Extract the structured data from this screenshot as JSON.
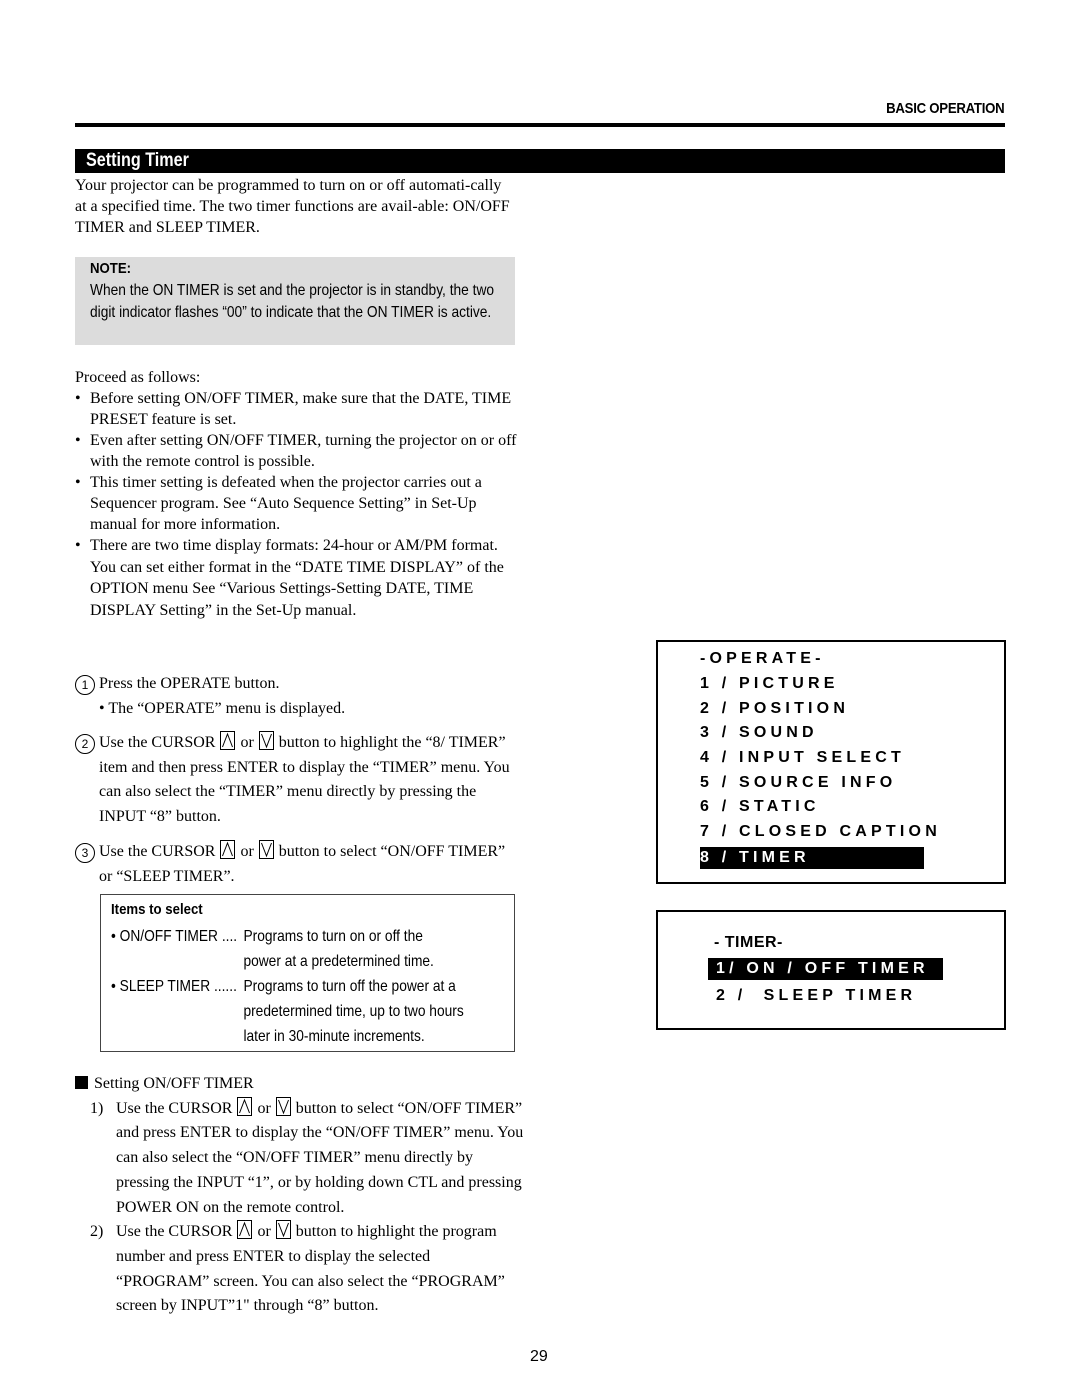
{
  "header": {
    "section_label": "BASIC OPERATION",
    "title": "Setting Timer"
  },
  "intro": "Your projector can be programmed to turn on or off automati-cally at a specified time. The two timer functions are avail-able: ON/OFF TIMER and SLEEP TIMER.",
  "note": {
    "title": "NOTE:",
    "text": "When the ON TIMER is set and the projector is in standby, the two digit  indicator flashes “00” to indicate that the ON TIMER is active."
  },
  "proceed": {
    "lead": "Proceed as follows:",
    "bullets": [
      "Before setting ON/OFF TIMER, make sure that the DATE, TIME PRESET feature is set.",
      "Even after setting ON/OFF TIMER, turning the projector on or off with the remote control is possible.",
      "This timer setting is defeated when the projector carries out a Sequencer program. See “Auto Sequence Setting” in Set-Up manual for more information.",
      "There are two time display formats: 24-hour or AM/PM format. You can set either format in the “DATE TIME DISPLAY” of the OPTION menu See “Various Settings-Setting DATE, TIME DISPLAY Setting” in the Set-Up manual."
    ]
  },
  "steps": [
    {
      "num": "1",
      "text": "Press the OPERATE button.",
      "sub": "• The “OPERATE” menu is displayed."
    },
    {
      "num": "2",
      "pre": "Use the CURSOR",
      "or": "or",
      "post": "button to highlight the “8/ TIMER” item and then press ENTER to display the “TIMER” menu. You can also select the “TIMER” menu directly by pressing the INPUT “8” button."
    },
    {
      "num": "3",
      "pre": "Use the CURSOR",
      "or": "or",
      "post": "button to select “ON/OFF TIMER” or “SLEEP TIMER”."
    }
  ],
  "items_to_select": {
    "title": "Items to select",
    "items": [
      {
        "label": "• ON/OFF TIMER ....",
        "lines": [
          "Programs to turn on or off the",
          "power at a predetermined time."
        ]
      },
      {
        "label": "• SLEEP TIMER ......",
        "lines": [
          "Programs to turn off the power at a",
          "predetermined time, up to two hours",
          "later in 30-minute increments."
        ]
      }
    ]
  },
  "onoff_section": {
    "heading": "Setting ON/OFF TIMER",
    "steps": [
      {
        "num": "1)",
        "pre": "Use the CURSOR",
        "or": "or",
        "post": "button to select “ON/OFF TIMER” and press ENTER to display the “ON/OFF TIMER” menu. You can also select the  “ON/OFF TIMER” menu directly by pressing the INPUT “1”, or by holding down CTL and pressing POWER ON on the remote control."
      },
      {
        "num": "2)",
        "pre": "Use the CURSOR",
        "or": "or",
        "post": "button to highlight the program number and press ENTER to display the selected “PROGRAM” screen. You can also select the “PROGRAM” screen by INPUT”1\" through “8” button."
      }
    ]
  },
  "operate_menu": {
    "title": "-OPERATE-",
    "items": [
      "1 / PICTURE",
      "2 / POSITION",
      "3 / SOUND",
      "4 / INPUT SELECT",
      "5 / SOURCE INFO",
      "6 / STATIC",
      "7 / CLOSED CAPTION",
      "8 / TIMER"
    ],
    "selected_index": 7
  },
  "timer_menu": {
    "title": "- TIMER-",
    "items": [
      "1/ ON / OFF TIMER",
      "2 /  SLEEP TIMER"
    ],
    "selected_index": 0
  },
  "icons": {
    "cursor_up": "cursor-up-key-icon",
    "cursor_down": "cursor-down-key-icon"
  },
  "page_number": "29"
}
